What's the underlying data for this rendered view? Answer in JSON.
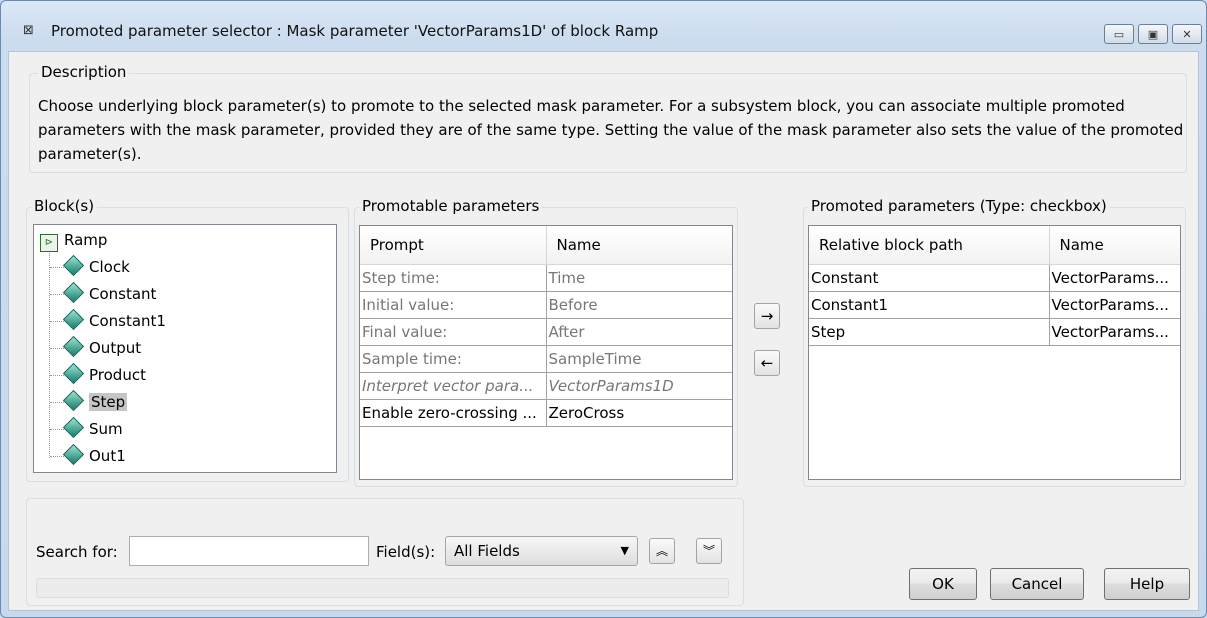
{
  "window": {
    "title": "Promoted parameter selector : Mask parameter 'VectorParams1D' of block Ramp",
    "app_icon": "simulink-block-icon",
    "controls": {
      "minimize": "▭",
      "maximize": "▣",
      "close": "✕"
    }
  },
  "description": {
    "label": "Description",
    "text": "Choose underlying block parameter(s) to promote to the selected mask parameter. For a subsystem block, you can associate multiple promoted parameters with the mask parameter, provided they are of the same type. Setting the value of the mask parameter also sets the value of the promoted parameter(s)."
  },
  "blocks": {
    "label": "Block(s)",
    "root": "Ramp",
    "root_icon": "subsystem-icon",
    "children": [
      "Clock",
      "Constant",
      "Constant1",
      "Output",
      "Product",
      "Step",
      "Sum",
      "Out1"
    ],
    "selected": "Step",
    "child_icon": "block-diamond-icon"
  },
  "promotable": {
    "label": "Promotable parameters",
    "columns": [
      "Prompt",
      "Name"
    ],
    "rows": [
      {
        "prompt": "Step time:",
        "name": "Time",
        "state": "disabled"
      },
      {
        "prompt": "Initial value:",
        "name": "Before",
        "state": "disabled"
      },
      {
        "prompt": "Final value:",
        "name": "After",
        "state": "disabled"
      },
      {
        "prompt": "Sample time:",
        "name": "SampleTime",
        "state": "disabled"
      },
      {
        "prompt": "Interpret vector para...",
        "name": "VectorParams1D",
        "state": "promoted"
      },
      {
        "prompt": "Enable zero-crossing ...",
        "name": "ZeroCross",
        "state": "normal"
      }
    ]
  },
  "transfer": {
    "add": "→",
    "remove": "←"
  },
  "promoted": {
    "label": "Promoted parameters (Type: checkbox)",
    "columns": [
      "Relative block path",
      "Name"
    ],
    "rows": [
      {
        "path": "Constant",
        "name": "VectorParams..."
      },
      {
        "path": "Constant1",
        "name": "VectorParams..."
      },
      {
        "path": "Step",
        "name": "VectorParams..."
      }
    ]
  },
  "search": {
    "label": "Search for:",
    "value": "",
    "fields_label": "Field(s):",
    "fields_value": "All Fields",
    "up": "︽",
    "down": "︾"
  },
  "buttons": {
    "ok": "OK",
    "cancel": "Cancel",
    "help": "Help"
  }
}
